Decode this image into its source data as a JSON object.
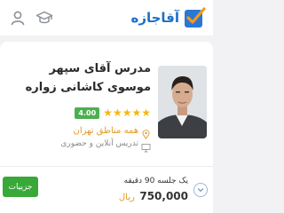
{
  "header": {
    "brand_name": "آقاجازه",
    "brand_logo": "aghajaze-logo",
    "icons": [
      "graduation-cap-icon",
      "user-icon"
    ]
  },
  "teacher": {
    "name": "مدرس آقای سپهر موسوی کاشانی زواره",
    "rating": 4.0,
    "rating_label": "4.00",
    "stars": "★★★★★",
    "region": "همه مناطق تهران",
    "teaching_mode": "تدریس آنلاین و حضوری"
  },
  "pricing": {
    "session": "یک جلسه 90 دقیقه",
    "amount": "750,000",
    "currency": "ریال"
  },
  "actions": {
    "details_label": "جزییات"
  },
  "colors": {
    "brand_blue": "#1f6fc8",
    "accent_orange": "#e39b2a",
    "star_gold": "#f5b80e",
    "badge_green": "#4caf50",
    "button_green": "#38a838"
  }
}
